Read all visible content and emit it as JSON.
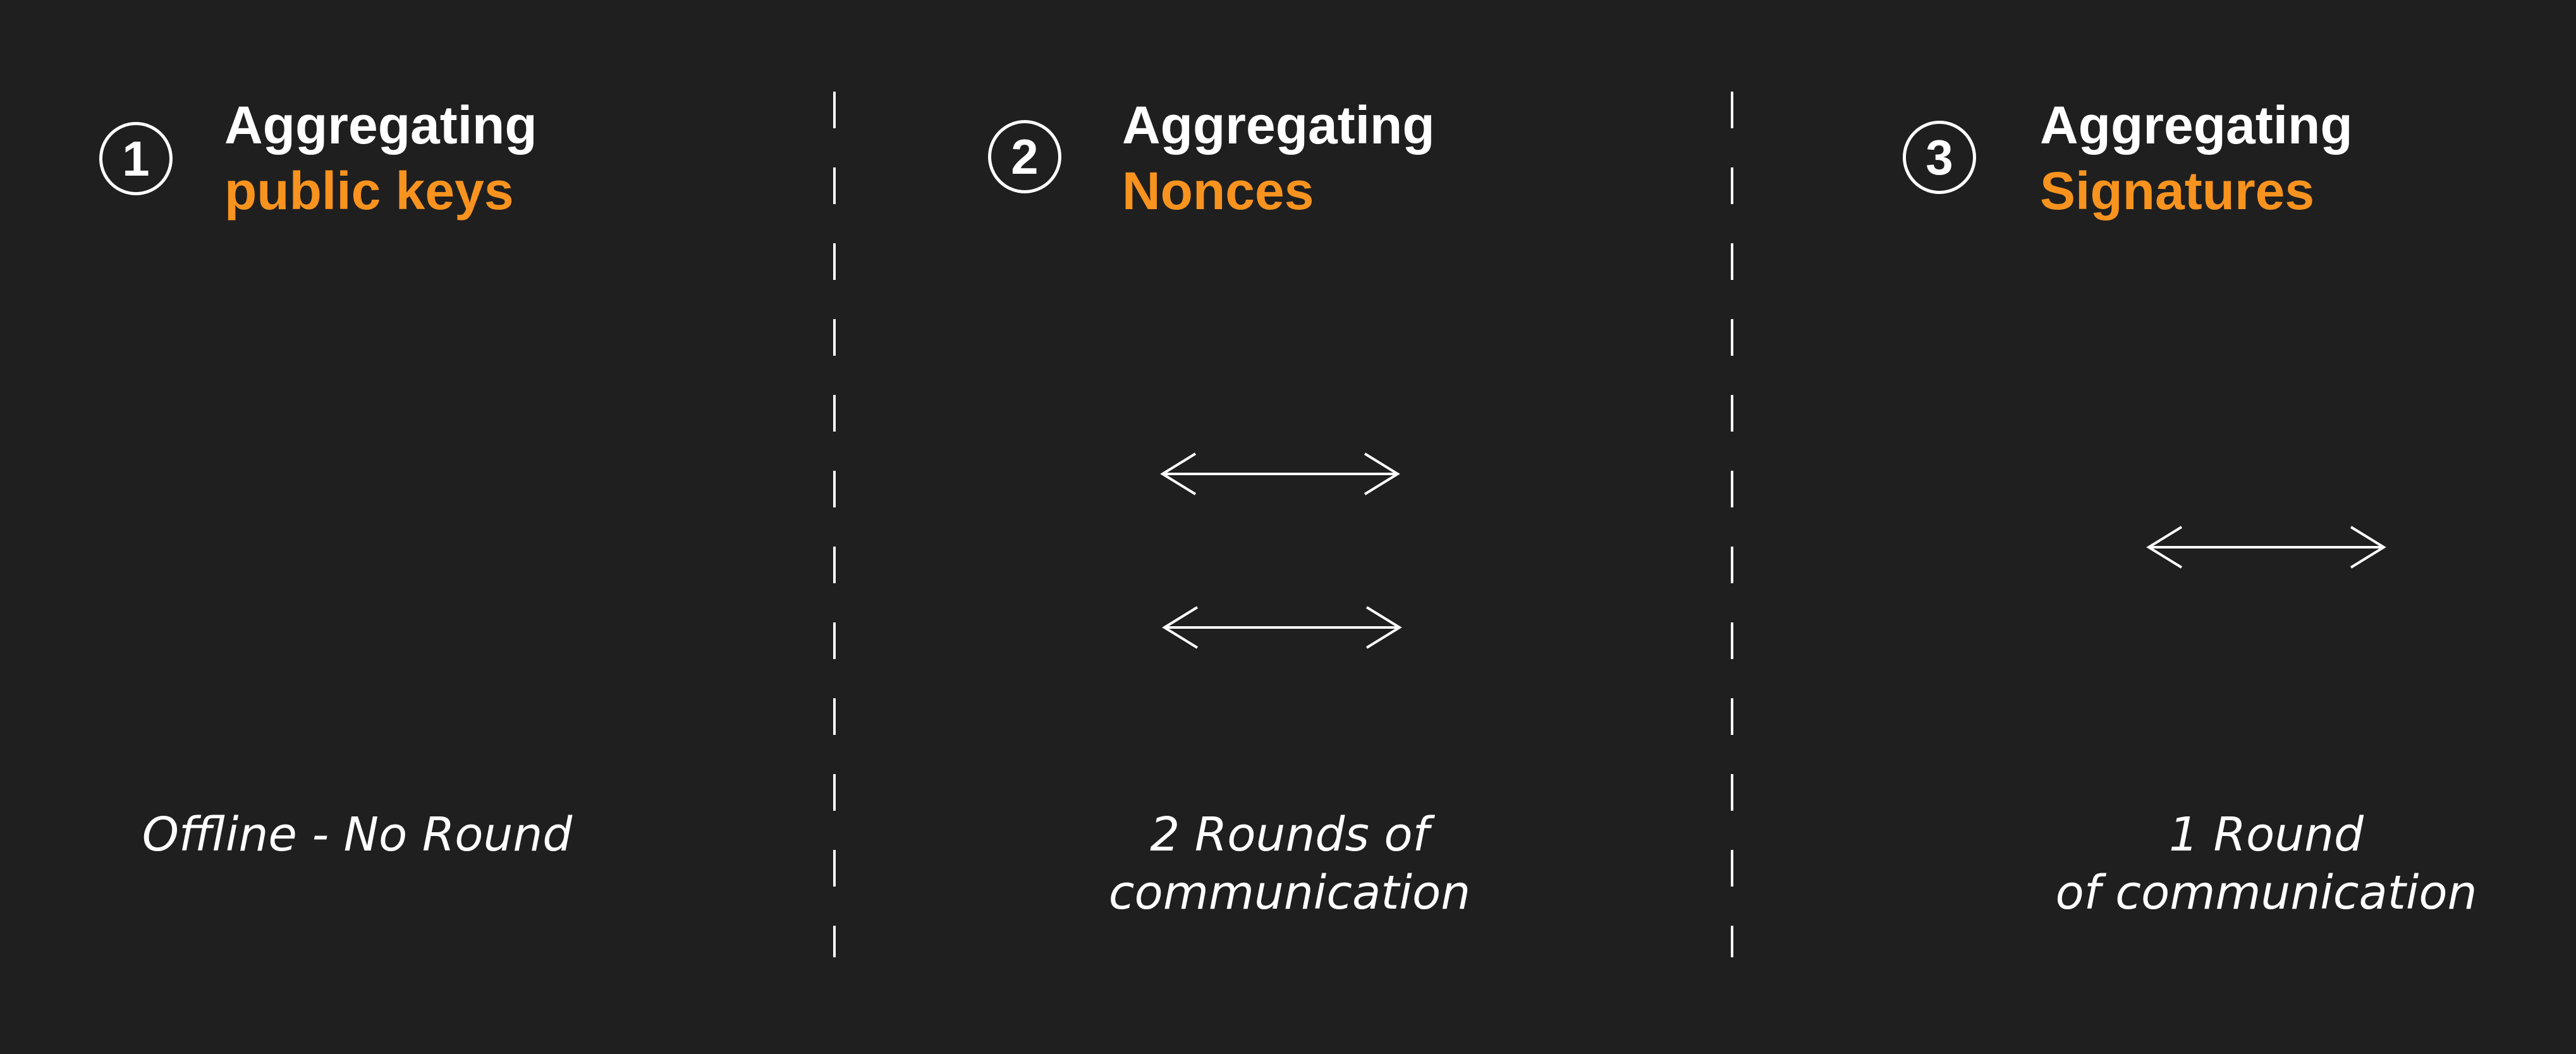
{
  "steps": [
    {
      "number": "1",
      "title": "Aggregating",
      "subtitle": "public keys",
      "caption_lines": [
        "Offline - No Round"
      ]
    },
    {
      "number": "2",
      "title": "Aggregating",
      "subtitle": "Nonces",
      "caption_lines": [
        "2 Rounds of",
        "communication"
      ]
    },
    {
      "number": "3",
      "title": "Aggregating",
      "subtitle": "Signatures",
      "caption_lines": [
        "1 Round",
        "of communication"
      ]
    }
  ],
  "colors": {
    "background": "#1f1f1f",
    "text": "#ffffff",
    "accent": "#f7931e"
  },
  "icons": [
    "double-arrow-icon"
  ]
}
